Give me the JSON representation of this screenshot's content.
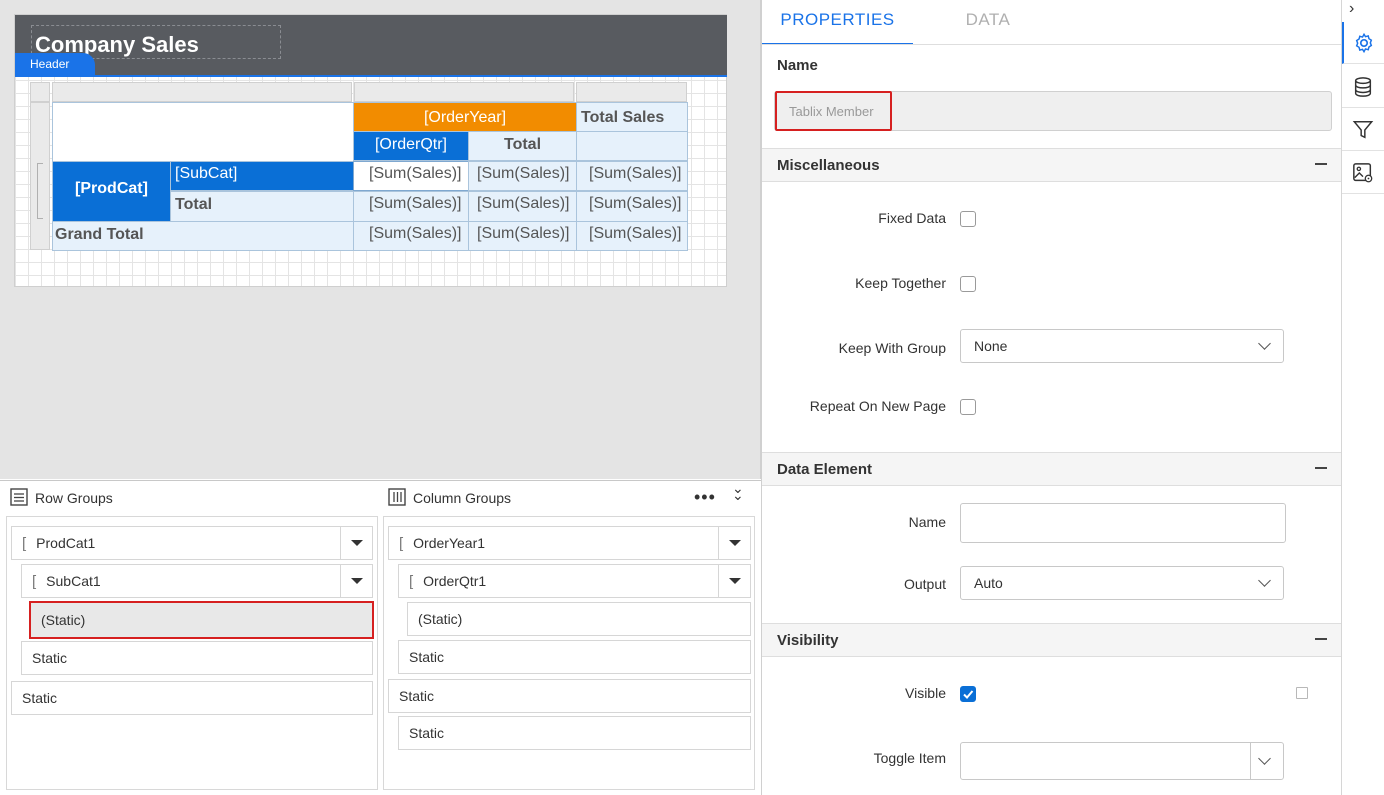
{
  "report": {
    "title": "Company Sales",
    "header_tag": "Header",
    "tablix": {
      "order_year": "[OrderYear]",
      "total_sales": "Total Sales",
      "order_qtr": "[OrderQtr]",
      "total": "Total",
      "prod_cat": "[ProdCat]",
      "sub_cat": "[SubCat]",
      "row_total": "Total",
      "grand_total": "Grand Total",
      "sum_sales": "[Sum(Sales)]"
    }
  },
  "groups": {
    "row_title": "Row Groups",
    "column_title": "Column Groups",
    "row_items": [
      "ProdCat1",
      "SubCat1",
      "(Static)",
      "Static",
      "Static"
    ],
    "column_items": [
      "OrderYear1",
      "OrderQtr1",
      "(Static)",
      "Static",
      "Static",
      "Static"
    ]
  },
  "properties": {
    "tabs": [
      "PROPERTIES",
      "DATA"
    ],
    "name_label": "Name",
    "name_value": "Tablix Member",
    "misc": {
      "title": "Miscellaneous",
      "fixed_data": "Fixed Data",
      "keep_together": "Keep Together",
      "keep_with_group": "Keep With Group",
      "keep_with_group_value": "None",
      "repeat_on_new_page": "Repeat On New Page"
    },
    "data_element": {
      "title": "Data Element",
      "name": "Name",
      "name_value": "",
      "output": "Output",
      "output_value": "Auto"
    },
    "visibility": {
      "title": "Visibility",
      "visible": "Visible",
      "toggle_item": "Toggle Item",
      "toggle_item_value": ""
    }
  },
  "colors": {
    "accent": "#1a73e8",
    "orange": "#f28c00",
    "selected_border": "#d62020"
  }
}
